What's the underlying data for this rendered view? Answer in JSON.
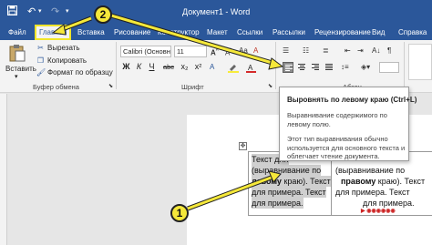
{
  "window": {
    "title": "Документ1 - Word"
  },
  "tabs": [
    {
      "label": "Файл",
      "active": false
    },
    {
      "label": "Главная",
      "active": true
    },
    {
      "label": "Вставка",
      "active": false
    },
    {
      "label": "Рисование",
      "active": false
    },
    {
      "label": "Конструктор",
      "active": false
    },
    {
      "label": "Макет",
      "active": false
    },
    {
      "label": "Ссылки",
      "active": false
    },
    {
      "label": "Рассылки",
      "active": false
    },
    {
      "label": "Рецензирование",
      "active": false
    },
    {
      "label": "Вид",
      "active": false
    },
    {
      "label": "Справка",
      "active": false
    }
  ],
  "clipboard": {
    "paste_label": "Вставить",
    "cut_label": "Вырезать",
    "copy_label": "Копировать",
    "format_painter_label": "Формат по образцу",
    "group_label": "Буфер обмена"
  },
  "font": {
    "name_value": "Calibri (Основн",
    "size_value": "11",
    "bold": "Ж",
    "italic": "К",
    "underline": "Ч",
    "strike": "abc",
    "subscript": "x₂",
    "superscript": "x²",
    "group_label": "Шрифт"
  },
  "paragraph": {
    "group_label": "Абзац"
  },
  "tooltip": {
    "title": "Выровнять по левому краю (Ctrl+L)",
    "description": "Выравнивание содержимого по левому полю.",
    "more": "Этот тип выравнивания обычно используется для основного текста и облегчает чтение документа."
  },
  "document": {
    "left_cell": {
      "line1": "Текст для",
      "line2": "(выравнивание по",
      "line3_bold": "левому",
      "line3_rest": " краю). Текст",
      "line4": "для примера. Текст",
      "line5": "для примера."
    },
    "right_cell": {
      "line1": "(выравнивание по",
      "line2_bold": "правому",
      "line2_rest": " краю). Текст",
      "line3": "для примера. Текст",
      "line4": "для примера."
    }
  },
  "annotations": {
    "badge1": "1",
    "badge2": "2",
    "color": "#f5e83a"
  },
  "icons": {
    "save": "save-icon",
    "undo": "undo-icon",
    "redo": "redo-icon",
    "paste": "clipboard-icon",
    "cut": "scissors-icon",
    "copy": "copy-icon",
    "format_painter": "brush-icon",
    "align_left": "align-left-icon",
    "align_center": "align-center-icon",
    "align_right": "align-right-icon",
    "justify": "justify-icon"
  },
  "colors": {
    "titlebar": "#2b579a",
    "ribbon": "#f3f3f3",
    "highlight_tab_border": "#f0e52a"
  }
}
